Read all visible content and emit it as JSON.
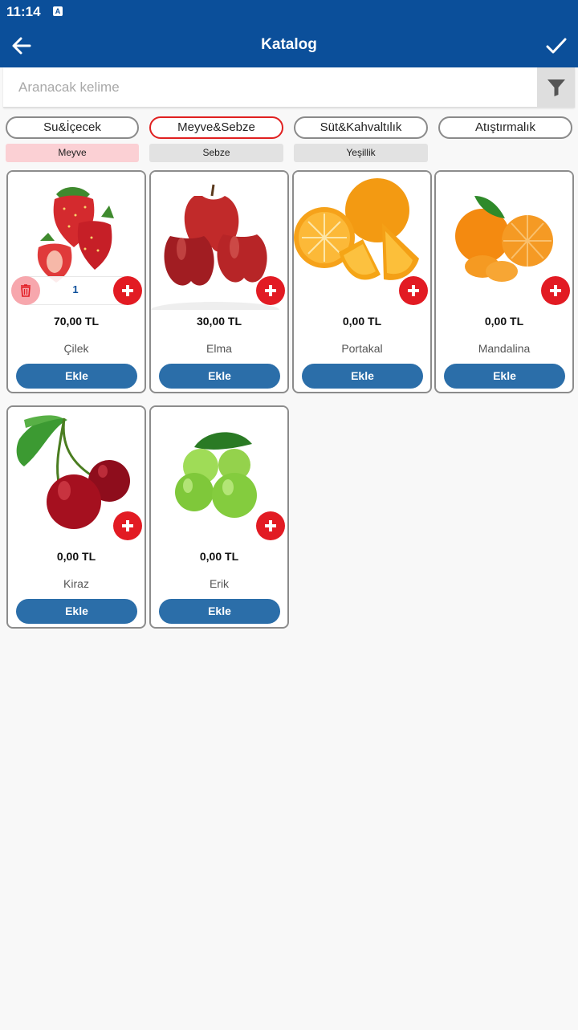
{
  "status_bar": {
    "time": "11:14",
    "notification_glyph": "A"
  },
  "app_bar": {
    "title": "Katalog",
    "back_icon": "arrow-left-icon",
    "confirm_icon": "check-icon"
  },
  "search": {
    "placeholder": "Aranacak kelime",
    "value": "",
    "filter_icon": "funnel-icon"
  },
  "categories": [
    {
      "label": "Su&İçecek",
      "active": false
    },
    {
      "label": "Meyve&Sebze",
      "active": true
    },
    {
      "label": "Süt&Kahvaltılık",
      "active": false
    },
    {
      "label": "Atıştırmalık",
      "active": false
    }
  ],
  "subcategories": [
    {
      "label": "Meyve",
      "active": true
    },
    {
      "label": "Sebze",
      "active": false
    },
    {
      "label": "Yeşillik",
      "active": false
    }
  ],
  "add_label": "Ekle",
  "colors": {
    "primary": "#0b4f9a",
    "accent_red": "#e21b23",
    "button_blue": "#2b6ea9",
    "active_sub_bg": "#fbd0d4"
  },
  "products": [
    {
      "name": "Çilek",
      "price": "70,00 TL",
      "quantity": "1",
      "image": "strawberry"
    },
    {
      "name": "Elma",
      "price": "30,00 TL",
      "image": "apple"
    },
    {
      "name": "Portakal",
      "price": "0,00 TL",
      "image": "orange"
    },
    {
      "name": "Mandalina",
      "price": "0,00 TL",
      "image": "tangerine"
    },
    {
      "name": "Kiraz",
      "price": "0,00 TL",
      "image": "cherry"
    },
    {
      "name": "Erik",
      "price": "0,00 TL",
      "image": "green-plum"
    }
  ]
}
